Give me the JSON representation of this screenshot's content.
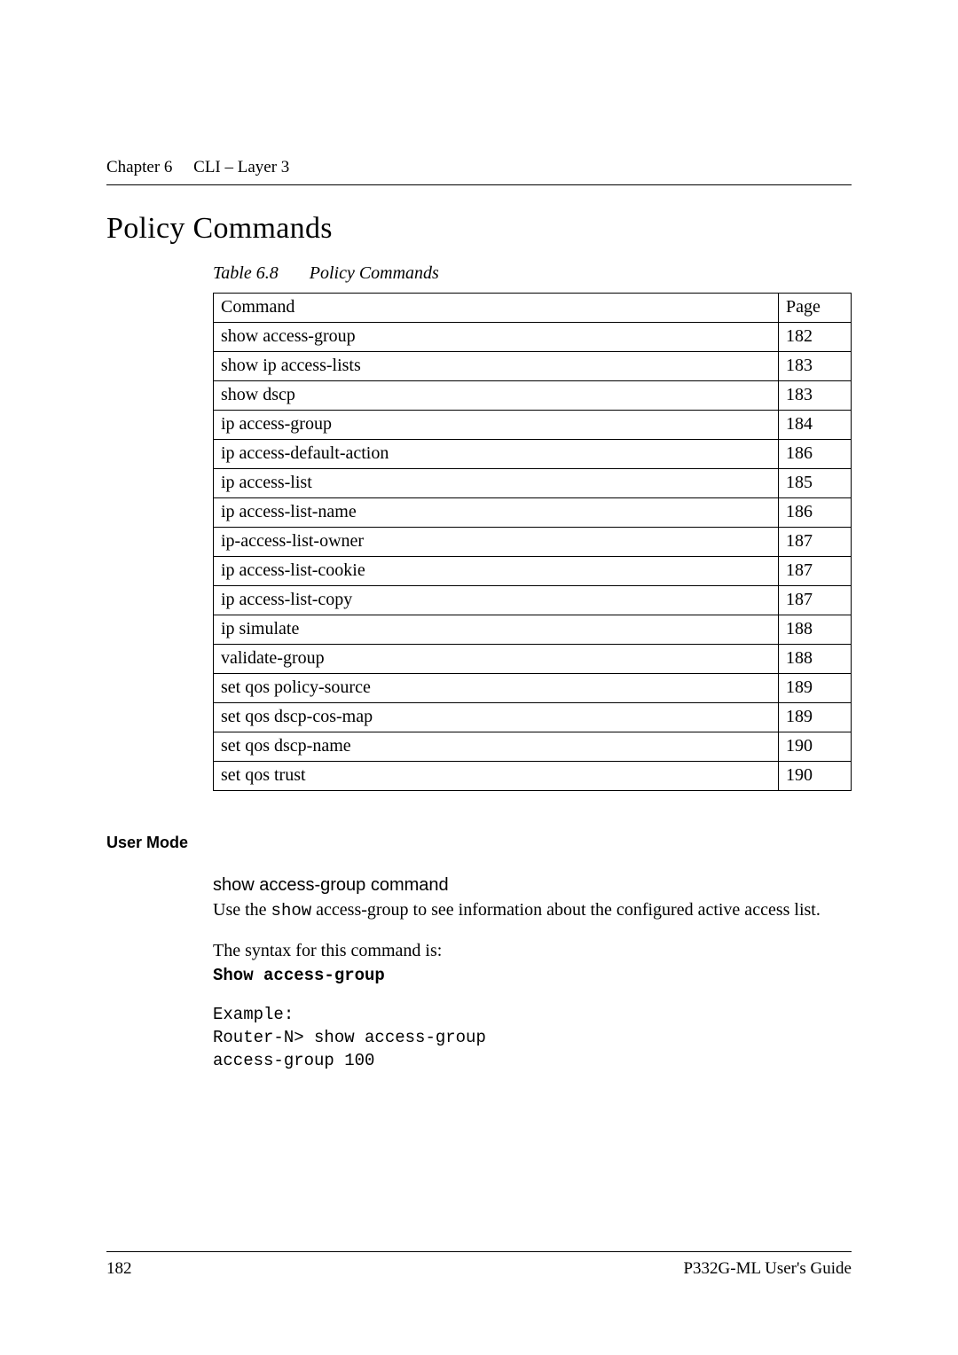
{
  "runningHead": {
    "chapter": "Chapter 6",
    "title": "CLI – Layer 3"
  },
  "heading": "Policy Commands",
  "tableCaption": {
    "num": "Table 6.8",
    "title": "Policy Commands"
  },
  "tableHeaders": {
    "col1": "Command",
    "col2": "Page"
  },
  "commands": [
    {
      "name": "show access-group",
      "page": "182"
    },
    {
      "name": "show ip access-lists",
      "page": "183"
    },
    {
      "name": "show dscp",
      "page": "183"
    },
    {
      "name": "ip access-group",
      "page": "184"
    },
    {
      "name": "ip access-default-action",
      "page": "186"
    },
    {
      "name": "ip access-list",
      "page": "185"
    },
    {
      "name": "ip access-list-name",
      "page": "186"
    },
    {
      "name": "ip-access-list-owner",
      "page": "187"
    },
    {
      "name": "ip access-list-cookie",
      "page": "187"
    },
    {
      "name": "ip access-list-copy",
      "page": "187"
    },
    {
      "name": "ip simulate",
      "page": "188"
    },
    {
      "name": "validate-group",
      "page": "188"
    },
    {
      "name": "set qos policy-source",
      "page": "189"
    },
    {
      "name": "set qos dscp-cos-map",
      "page": "189"
    },
    {
      "name": "set qos dscp-name",
      "page": "190"
    },
    {
      "name": "set qos trust",
      "page": "190"
    }
  ],
  "sectionHead": "User Mode",
  "subHead": "show access-group command",
  "desc": {
    "pre": "Use the ",
    "code": "show",
    "post": " access-group to see information about the configured active access list."
  },
  "syntaxIntro": "The syntax for this command is:",
  "syntaxCmd": "Show access-group",
  "example": {
    "label": "Example:",
    "line1": "Router-N> show access-group",
    "line2": "access-group 100"
  },
  "footer": {
    "pageNum": "182",
    "guide": "P332G-ML User's Guide"
  }
}
